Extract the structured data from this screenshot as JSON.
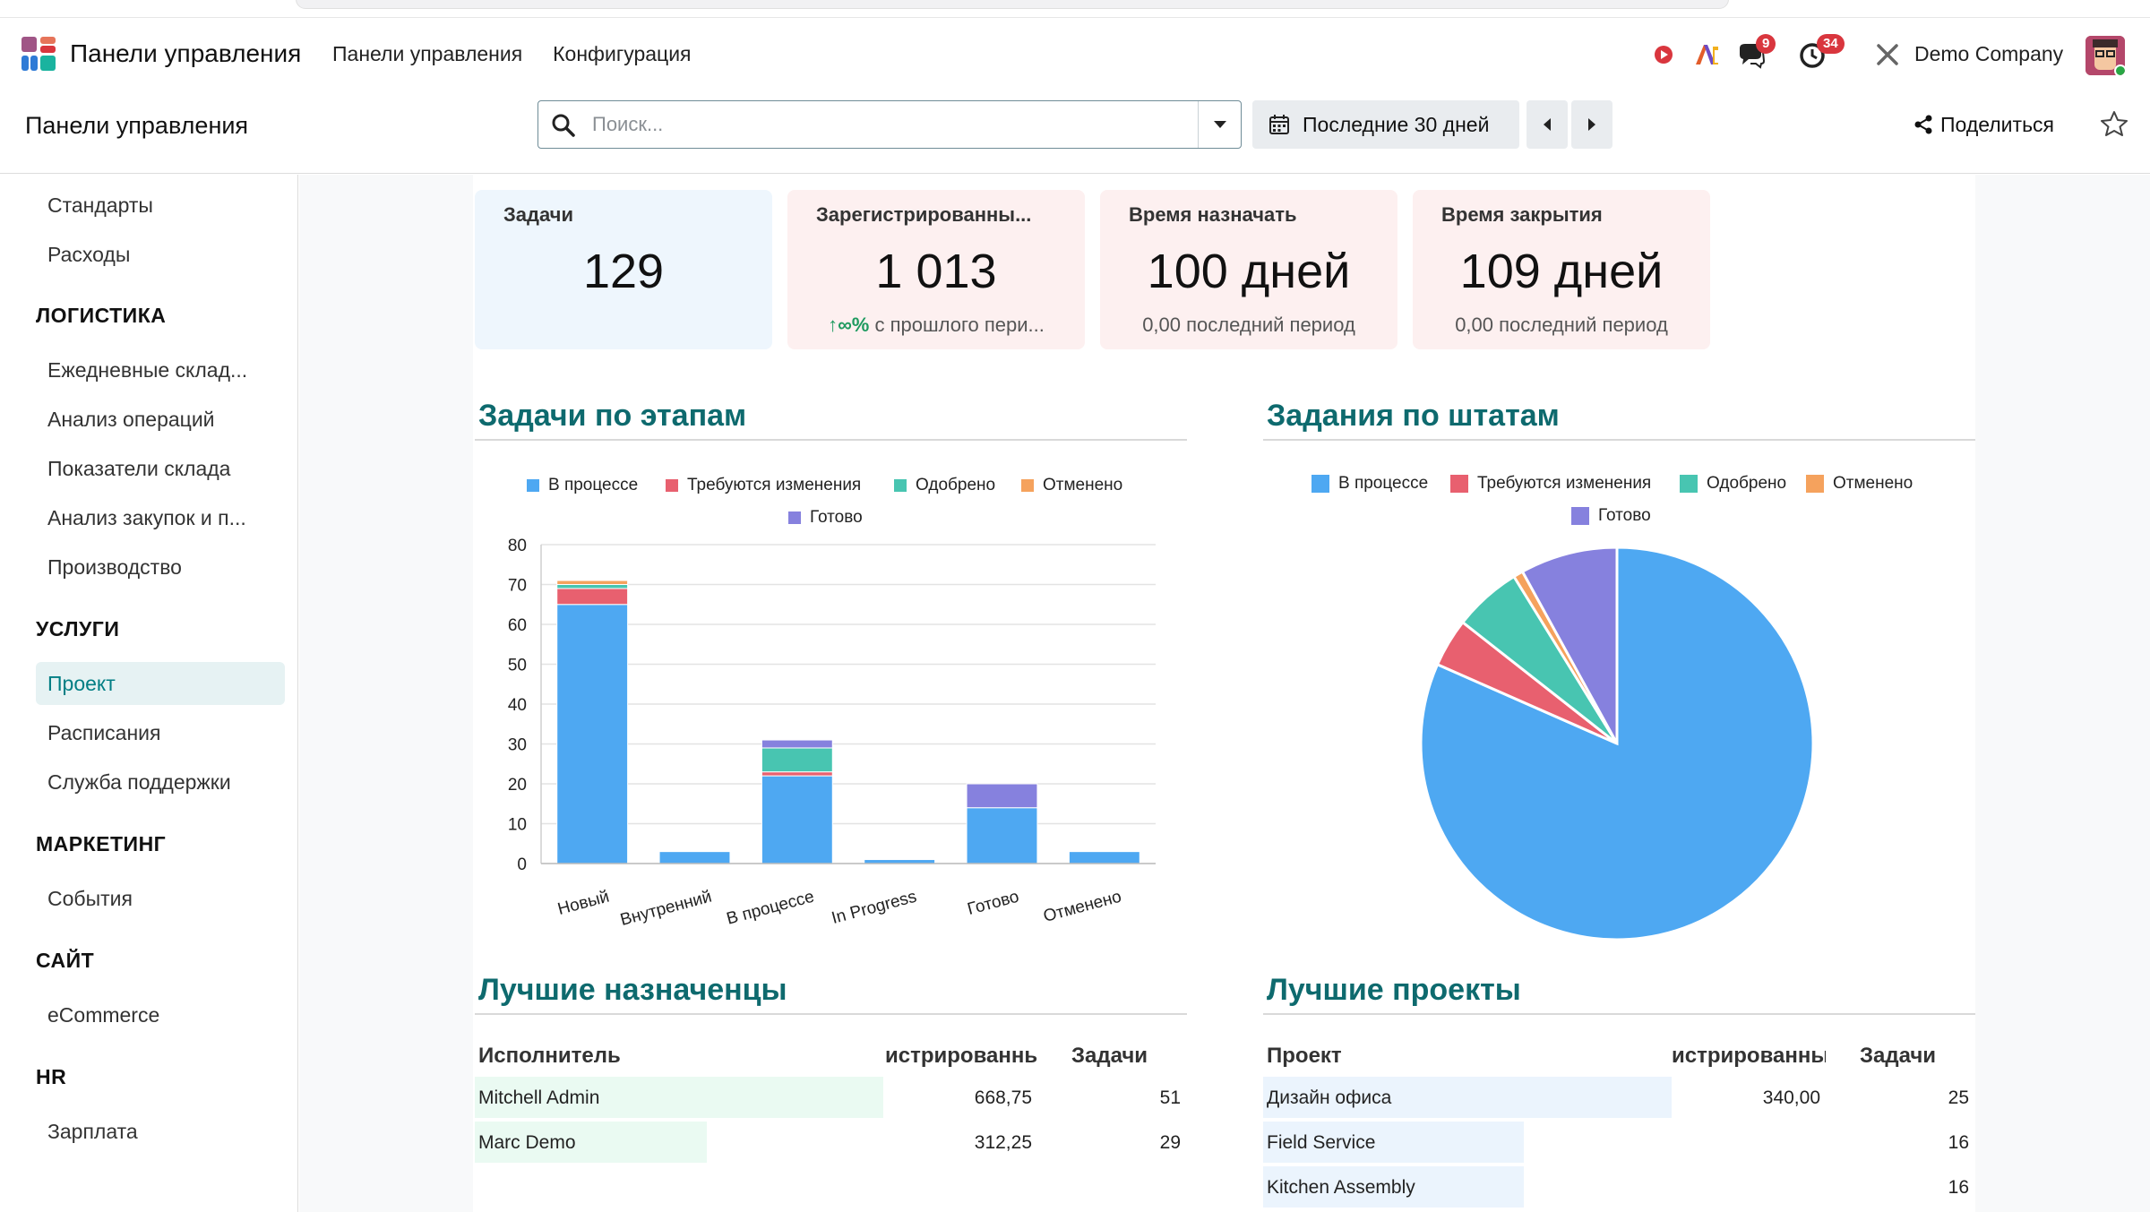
{
  "navbar": {
    "app_name": "Панели управления",
    "menu": [
      "Панели управления",
      "Конфигурация"
    ],
    "chat_badge": "9",
    "activity_badge": "34",
    "company": "Demo Company"
  },
  "control_panel": {
    "title": "Панели управления",
    "search_placeholder": "Поиск...",
    "date_filter": "Последние 30 дней",
    "share_label": "Поделиться"
  },
  "sidebar": {
    "items_top": [
      "Стандарты",
      "Расходы"
    ],
    "sections": [
      {
        "title": "ЛОГИСТИКА",
        "items": [
          "Ежедневные склад...",
          "Анализ операций",
          "Показатели склада",
          "Анализ закупок и п...",
          "Производство"
        ]
      },
      {
        "title": "УСЛУГИ",
        "items": [
          "Проект",
          "Расписания",
          "Служба поддержки"
        ]
      },
      {
        "title": "МАРКЕТИНГ",
        "items": [
          "События"
        ]
      },
      {
        "title": "САЙТ",
        "items": [
          "eCommerce"
        ]
      },
      {
        "title": "HR",
        "items": [
          "Зарплата"
        ]
      }
    ],
    "active_item": "Проект"
  },
  "kpis": [
    {
      "title": "Задачи",
      "value": "129",
      "subtitle": "",
      "bg": "#eef6fd"
    },
    {
      "title": "Зарегистрированны...",
      "value": "1 013",
      "trend": "↑∞%",
      "subtitle": "с прошлого пери...",
      "bg": "#fdf0f0"
    },
    {
      "title": "Время назначать",
      "value": "100 дней",
      "subtitle": "0,00 последний период",
      "bg": "#fdf0f0"
    },
    {
      "title": "Время закрытия",
      "value": "109 дней",
      "subtitle": "0,00 последний период",
      "bg": "#fdf0f0"
    }
  ],
  "sections": {
    "bar_title": "Задачи по этапам",
    "pie_title": "Задания по штатам",
    "assignees_title": "Лучшие назначенцы",
    "projects_title": "Лучшие проекты"
  },
  "colors": {
    "in_progress": "#4ea8f2",
    "changes": "#e8606f",
    "approved": "#48c5b1",
    "cancelled": "#f5a25d",
    "done": "#8681de",
    "accent": "#017e84"
  },
  "chart_data": [
    {
      "type": "bar",
      "stacked": true,
      "categories": [
        "Новый",
        "Внутренний",
        "В процессе",
        "In Progress",
        "Готово",
        "Отменено"
      ],
      "series": [
        {
          "name": "В процессе",
          "values": [
            65,
            3,
            22,
            1,
            14,
            3
          ]
        },
        {
          "name": "Требуются изменения",
          "values": [
            4,
            0,
            1,
            0,
            0,
            0
          ]
        },
        {
          "name": "Одобрено",
          "values": [
            1,
            0,
            6,
            0,
            0,
            0
          ]
        },
        {
          "name": "Отменено",
          "values": [
            1,
            0,
            0,
            0,
            0,
            0
          ]
        },
        {
          "name": "Готово",
          "values": [
            0,
            0,
            2,
            0,
            6,
            0
          ]
        }
      ],
      "ylim": [
        0,
        80
      ],
      "yticks": [
        "0",
        "10",
        "20",
        "30",
        "40",
        "50",
        "60",
        "70",
        "80"
      ],
      "grid": true,
      "legend": "top"
    },
    {
      "type": "pie",
      "labels": [
        "В процессе",
        "Требуются изменения",
        "Одобрено",
        "Отменено",
        "Готово"
      ],
      "values": [
        102,
        5,
        7,
        1,
        10
      ],
      "legend": "top"
    }
  ],
  "assignees_table": {
    "headers": [
      "Исполнитель",
      "истрированны",
      "Задачи"
    ],
    "rows": [
      {
        "name": "Mitchell Admin",
        "hours": "668,75",
        "tasks": "51",
        "ratio": 1.0
      },
      {
        "name": "Marc Demo",
        "hours": "312,25",
        "tasks": "29",
        "ratio": 0.57
      }
    ]
  },
  "projects_table": {
    "headers": [
      "Проект",
      "истрированны",
      "Задачи"
    ],
    "rows": [
      {
        "name": "Дизайн офиса",
        "hours": "340,00",
        "tasks": "25",
        "ratio": 1.0
      },
      {
        "name": "Field Service",
        "hours": "",
        "tasks": "16",
        "ratio": 0.64
      },
      {
        "name": "Kitchen Assembly",
        "hours": "",
        "tasks": "16",
        "ratio": 0.64
      }
    ]
  }
}
